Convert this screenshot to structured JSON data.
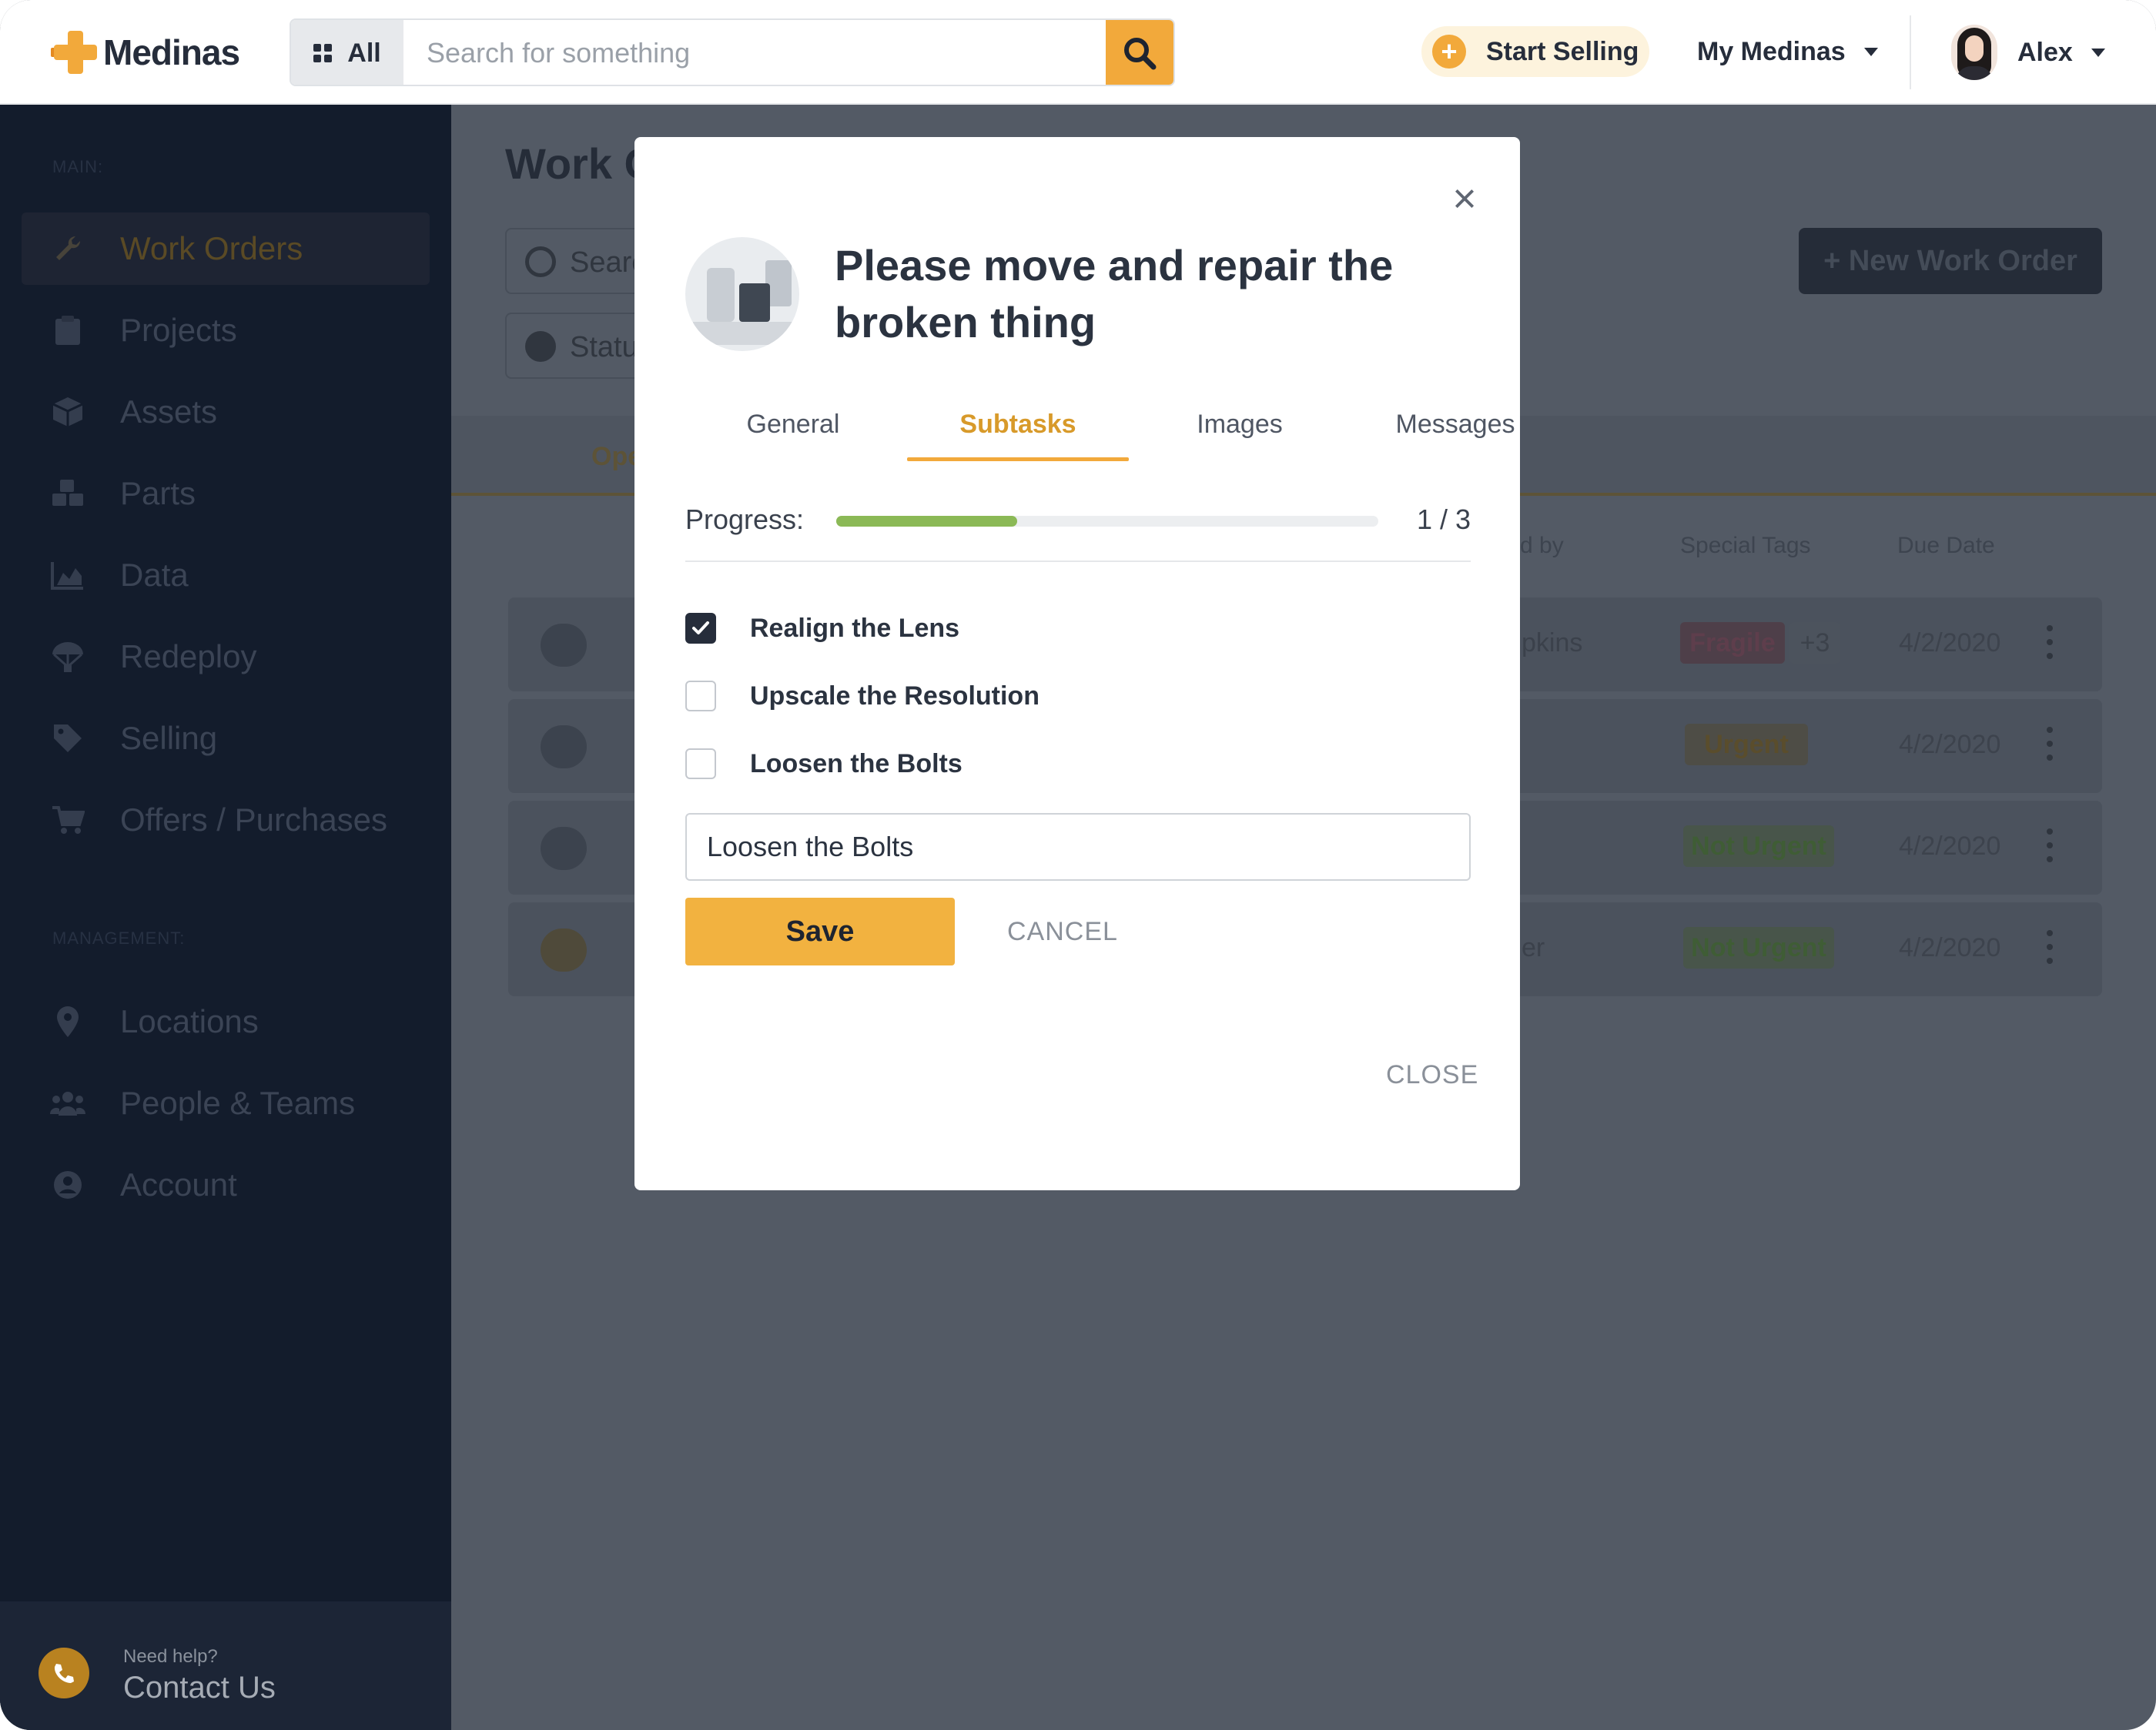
{
  "header": {
    "logo_text": "Medinas",
    "search_scope": "All",
    "search_placeholder": "Search for something",
    "start_selling": "Start Selling",
    "my_medinas": "My Medinas",
    "user_name": "Alex"
  },
  "sidebar": {
    "main_section": "MAIN:",
    "management_section": "MANAGEMENT:",
    "main_items": [
      {
        "label": "Work Orders",
        "icon": "wrench-icon"
      },
      {
        "label": "Projects",
        "icon": "clipboard-icon"
      },
      {
        "label": "Assets",
        "icon": "box-icon"
      },
      {
        "label": "Parts",
        "icon": "cubes-icon"
      },
      {
        "label": "Data",
        "icon": "area-chart-icon"
      },
      {
        "label": "Redeploy",
        "icon": "parachute-icon"
      },
      {
        "label": "Selling",
        "icon": "tag-icon"
      },
      {
        "label": "Offers / Purchases",
        "icon": "cart-icon"
      }
    ],
    "management_items": [
      {
        "label": "Locations",
        "icon": "map-pin-icon"
      },
      {
        "label": "People & Teams",
        "icon": "users-icon"
      },
      {
        "label": "Account",
        "icon": "user-circle-icon"
      }
    ],
    "contact": {
      "need_help": "Need help?",
      "label": "Contact Us"
    }
  },
  "background": {
    "title": "Work O",
    "search_partial": "Searc",
    "status_partial": "Statu",
    "new_work_order": "+ New Work Order",
    "open_tab_partial": "Ope",
    "columns": {
      "assigned_partial": "d by",
      "special_tags": "Special Tags",
      "due_date": "Due Date"
    },
    "rows": [
      {
        "name_partial": "pkins",
        "tag": "Fragile",
        "extra": "+3",
        "date": "4/2/2020"
      },
      {
        "name_partial": "",
        "tag": "Urgent",
        "extra": "",
        "date": "4/2/2020"
      },
      {
        "name_partial": "",
        "tag": "Not Urgent",
        "extra": "",
        "date": "4/2/2020"
      },
      {
        "name_partial": "er",
        "tag": "Not Urgent",
        "extra": "",
        "date": "4/2/2020"
      }
    ]
  },
  "modal": {
    "title": "Please move and repair the broken thing",
    "tabs": [
      "General",
      "Subtasks",
      "Images",
      "Messages"
    ],
    "active_tab": "Subtasks",
    "progress_label": "Progress:",
    "progress_count": "1 / 3",
    "progress_fraction": 0.3333,
    "subtasks": [
      {
        "label": "Realign the Lens",
        "checked": true
      },
      {
        "label": "Upscale the Resolution",
        "checked": false
      },
      {
        "label": "Loosen the Bolts",
        "checked": false
      }
    ],
    "edit_value": "Loosen the Bolts",
    "save_label": "Save",
    "cancel_label": "CANCEL",
    "close_label": "CLOSE"
  },
  "colors": {
    "accent": "#f2a93b",
    "sidebar_bg": "#131c2c",
    "progress_fill": "#8bb956",
    "text_dark": "#2b3340"
  }
}
